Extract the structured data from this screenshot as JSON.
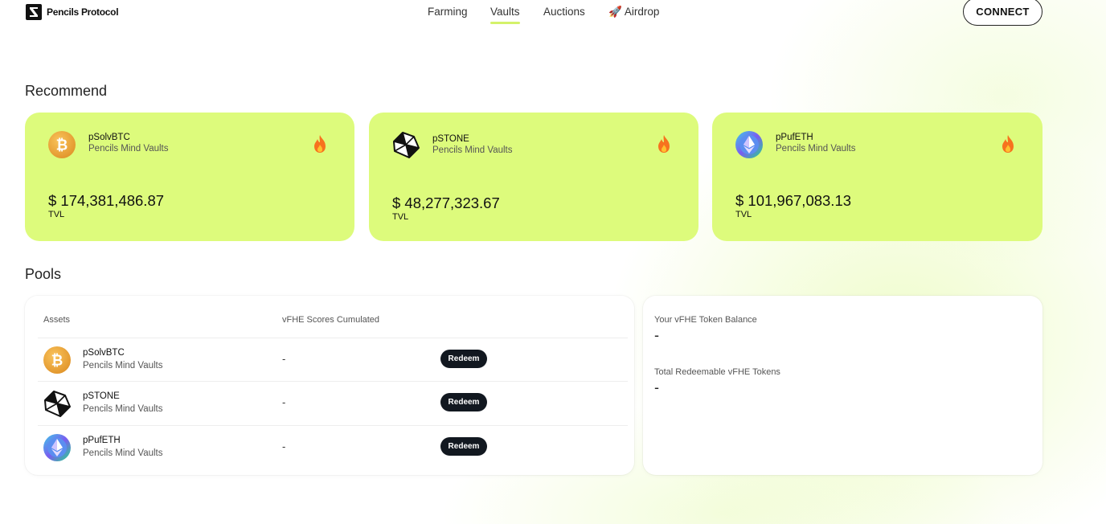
{
  "header": {
    "brand": "Pencils Protocol",
    "nav": {
      "farming": "Farming",
      "vaults": "Vaults",
      "auctions": "Auctions",
      "airdrop": "🚀 Airdrop"
    },
    "active_nav": "Vaults",
    "connect_label": "CONNECT"
  },
  "recommend": {
    "title": "Recommend",
    "cards": [
      {
        "name": "pSolvBTC",
        "subtitle": "Pencils Mind Vaults",
        "value": "$ 174,381,486.87",
        "label": "TVL",
        "icon": "bitcoin-icon"
      },
      {
        "name": "pSTONE",
        "subtitle": "Pencils Mind Vaults",
        "value": "$ 48,277,323.67",
        "label": "TVL",
        "icon": "stone-icon"
      },
      {
        "name": "pPufETH",
        "subtitle": "Pencils Mind Vaults",
        "value": "$ 101,967,083.13",
        "label": "TVL",
        "icon": "pufeth-icon"
      }
    ]
  },
  "pools": {
    "title": "Pools",
    "headers": {
      "assets": "Assets",
      "scores": "vFHE Scores Cumulated"
    },
    "rows": [
      {
        "name": "pSolvBTC",
        "subtitle": "Pencils Mind Vaults",
        "score": "-",
        "action": "Redeem",
        "icon": "bitcoin-icon"
      },
      {
        "name": "pSTONE",
        "subtitle": "Pencils Mind Vaults",
        "score": "-",
        "action": "Redeem",
        "icon": "stone-icon"
      },
      {
        "name": "pPufETH",
        "subtitle": "Pencils Mind Vaults",
        "score": "-",
        "action": "Redeem",
        "icon": "pufeth-icon"
      }
    ]
  },
  "balance": {
    "token_balance_label": "Your vFHE Token Balance",
    "token_balance_value": "-",
    "redeemable_label": "Total Redeemable vFHE Tokens",
    "redeemable_value": "-"
  },
  "colors": {
    "card_bg": "#ddfb7c",
    "nav_underline": "#d4f26a",
    "button_dark": "#121820",
    "fire": "#f7721e"
  }
}
